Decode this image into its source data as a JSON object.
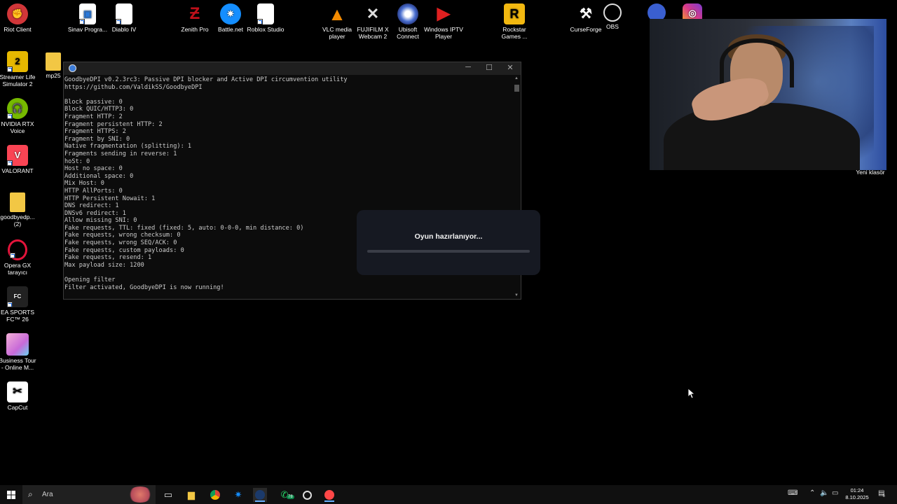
{
  "desktop": {
    "top_icons": [
      {
        "label": "Riot Client",
        "icon": "riot-fist-icon",
        "color": "#d13639"
      },
      {
        "label": "Sinav Progra...",
        "icon": "document-icon",
        "color": "#ffffff"
      },
      {
        "label": "Diablo IV",
        "icon": "document-icon",
        "color": "#ffffff"
      },
      {
        "label": "Zenith Pro",
        "icon": "zenith-icon",
        "color": "#c0101a"
      },
      {
        "label": "Battle.net",
        "icon": "battlenet-icon",
        "color": "#148eff"
      },
      {
        "label": "Roblox Studio",
        "icon": "document-icon",
        "color": "#ffffff"
      },
      {
        "label": "VLC media player",
        "icon": "vlc-cone-icon",
        "color": "#f48a00"
      },
      {
        "label": "FUJIFILM X Webcam 2",
        "icon": "fujifilm-icon",
        "color": "#dddddd"
      },
      {
        "label": "Ubisoft Connect",
        "icon": "ubisoft-icon",
        "color": "#4a6fd0"
      },
      {
        "label": "Windows IPTV Player",
        "icon": "iptv-play-icon",
        "color": "#e02020"
      },
      {
        "label": "Rockstar Games ...",
        "icon": "rockstar-icon",
        "color": "#f2b810"
      },
      {
        "label": "CurseForge",
        "icon": "anvil-icon",
        "color": "#ffffff"
      },
      {
        "label": "OBS",
        "icon": "obs-icon",
        "color": "#dddddd"
      },
      {
        "label": "",
        "icon": "circle-app-icon",
        "color": "#3a5fd0"
      },
      {
        "label": "",
        "icon": "instagram-icon",
        "color": "#d93a8a"
      }
    ],
    "left_icons": [
      {
        "label": "mp25",
        "icon": "folder-icon",
        "color": "#f2c744"
      },
      {
        "label": "Streamer Life Simulator 2",
        "icon": "streamer-life-icon",
        "color": "#e6b800"
      },
      {
        "label": "NVIDIA RTX Voice",
        "icon": "nvidia-headset-icon",
        "color": "#76b900"
      },
      {
        "label": "VALORANT",
        "icon": "valorant-icon",
        "color": "#fa4454"
      },
      {
        "label": "goodbyedp... (2)",
        "icon": "folder-icon",
        "color": "#f2c744"
      },
      {
        "label": "Opera GX tarayıcı",
        "icon": "opera-gx-icon",
        "color": "#e3143b"
      },
      {
        "label": "EA SPORTS FC™ 26",
        "icon": "ea-fc-icon",
        "color": "#222222"
      },
      {
        "label": "Business Tour - Online M...",
        "icon": "business-tour-icon",
        "color": "#c86ad8"
      },
      {
        "label": "CapCut",
        "icon": "capcut-icon",
        "color": "#ffffff"
      }
    ],
    "webcam_label": "Yeni klasör"
  },
  "console": {
    "title": "",
    "lines": [
      "GoodbyeDPI v0.2.3rc3: Passive DPI blocker and Active DPI circumvention utility",
      "https://github.com/ValdikSS/GoodbyeDPI",
      "",
      "Block passive: 0",
      "Block QUIC/HTTP3: 0",
      "Fragment HTTP: 2",
      "Fragment persistent HTTP: 2",
      "Fragment HTTPS: 2",
      "Fragment by SNI: 0",
      "Native fragmentation (splitting): 1",
      "Fragments sending in reverse: 1",
      "hoSt: 0",
      "Host no space: 0",
      "Additional space: 0",
      "Mix Host: 0",
      "HTTP AllPorts: 0",
      "HTTP Persistent Nowait: 1",
      "DNS redirect: 1",
      "DNSv6 redirect: 1",
      "Allow missing SNI: 0",
      "Fake requests, TTL: fixed (fixed: 5, auto: 0-0-0, min distance: 0)",
      "Fake requests, wrong checksum: 0",
      "Fake requests, wrong SEQ/ACK: 0",
      "Fake requests, custom payloads: 0",
      "Fake requests, resend: 1",
      "Max payload size: 1200",
      "",
      "Opening filter",
      "Filter activated, GoodbyeDPI is now running!"
    ],
    "controls": {
      "minimize": "─",
      "maximize": "☐",
      "close": "✕"
    }
  },
  "loading_dialog": {
    "text": "Oyun hazırlanıyor...",
    "progress": 0.0
  },
  "taskbar": {
    "search_placeholder": "Ara",
    "whatsapp_badge": "78",
    "clock_time": "01:24",
    "clock_date": "8.10.2025",
    "notification_count": "6"
  }
}
